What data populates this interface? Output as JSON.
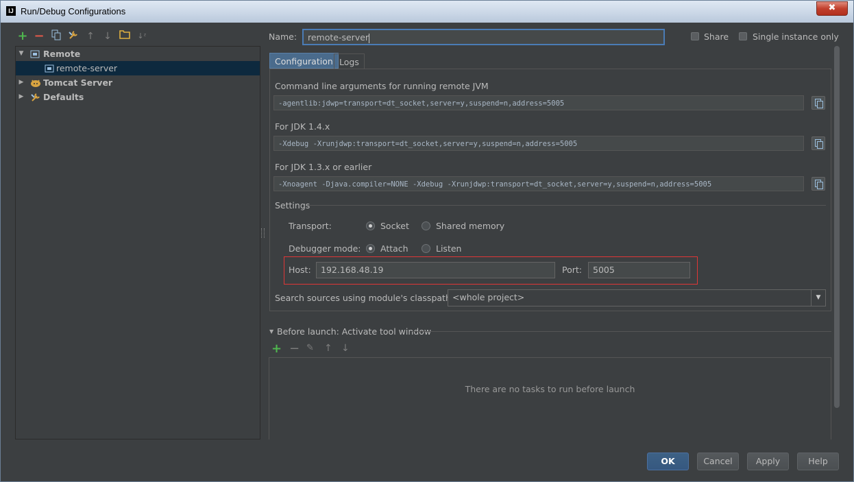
{
  "window": {
    "title": "Run/Debug Configurations",
    "app_icon": "IJ",
    "close_label": "✖"
  },
  "left_toolbar": {
    "icons": [
      {
        "name": "add-icon",
        "glyph": "+",
        "color": "#4fb74f"
      },
      {
        "name": "remove-icon",
        "glyph": "−",
        "color": "#e05a4a"
      },
      {
        "name": "copy-icon",
        "glyph": "❐",
        "color": "#9cc0e0"
      },
      {
        "name": "wrench-icon",
        "glyph": "⚒",
        "color": "#9cc0e0"
      },
      {
        "name": "move-up-icon",
        "glyph": "↑",
        "color": "#8a8a8a"
      },
      {
        "name": "move-down-icon",
        "glyph": "↓",
        "color": "#8a8a8a"
      },
      {
        "name": "folder-icon",
        "glyph": "■",
        "color": "#e0b040"
      },
      {
        "name": "sort-icon",
        "glyph": "⇵",
        "color": "#8a8a8a"
      }
    ]
  },
  "tree": {
    "remote": "Remote",
    "remote_server": "remote-server",
    "tomcat": "Tomcat Server",
    "defaults": "Defaults"
  },
  "name_field": {
    "label": "Name:",
    "value": "remote-server"
  },
  "share": {
    "label": "Share",
    "checked": false
  },
  "single_instance": {
    "label": "Single instance only",
    "checked": false
  },
  "tabs": [
    {
      "label": "Configuration",
      "active": true
    },
    {
      "label": "Logs",
      "active": false
    }
  ],
  "config": {
    "cmd_label": "Command line arguments for running remote JVM",
    "cmd_value": "-agentlib:jdwp=transport=dt_socket,server=y,suspend=n,address=5005",
    "jdk14_label": "For JDK 1.4.x",
    "jdk14_value": "-Xdebug -Xrunjdwp:transport=dt_socket,server=y,suspend=n,address=5005",
    "jdk13_label": "For JDK 1.3.x or earlier",
    "jdk13_value": "-Xnoagent -Djava.compiler=NONE -Xdebug -Xrunjdwp:transport=dt_socket,server=y,suspend=n,address=5005",
    "settings_label": "Settings",
    "transport_label": "Transport:",
    "transport_socket": "Socket",
    "transport_shared": "Shared memory",
    "transport_selected": "Socket",
    "debugger_label": "Debugger mode:",
    "debugger_attach": "Attach",
    "debugger_listen": "Listen",
    "debugger_selected": "Attach",
    "host_label": "Host:",
    "host_value": "192.168.48.19",
    "port_label": "Port:",
    "port_value": "5005",
    "search_label": "Search sources using module's classpath:",
    "search_value": "<whole project>"
  },
  "before_launch": {
    "title": "Before launch: Activate tool window",
    "empty_text": "There are no tasks to run before launch",
    "toolbar_icons": [
      "add-icon",
      "remove-icon",
      "edit-icon",
      "move-up-icon",
      "move-down-icon"
    ]
  },
  "buttons": {
    "ok": "OK",
    "cancel": "Cancel",
    "apply": "Apply",
    "help": "Help"
  }
}
